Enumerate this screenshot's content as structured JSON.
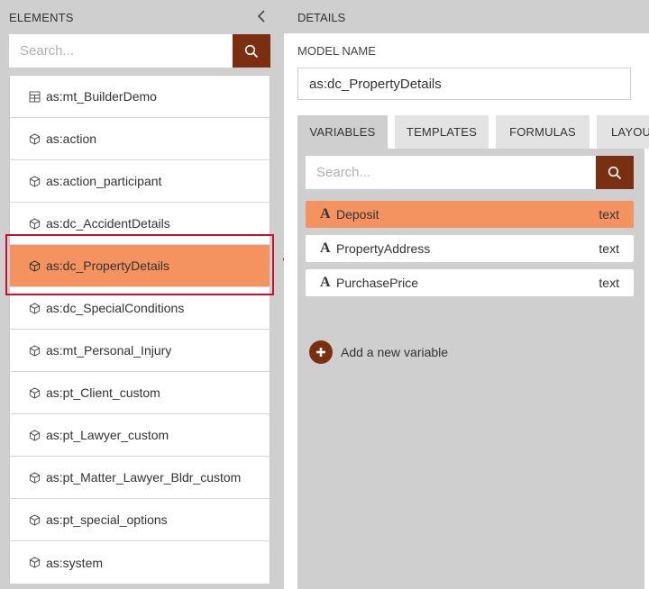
{
  "left": {
    "title": "ELEMENTS",
    "search": {
      "placeholder": "Search..."
    },
    "items": [
      {
        "label": "as:mt_BuilderDemo",
        "icon": "grid-icon"
      },
      {
        "label": "as:action",
        "icon": "cube-icon"
      },
      {
        "label": "as:action_participant",
        "icon": "cube-icon"
      },
      {
        "label": "as:dc_AccidentDetails",
        "icon": "cube-icon"
      },
      {
        "label": "as:dc_PropertyDetails",
        "icon": "cube-icon",
        "selected": true
      },
      {
        "label": "as:dc_SpecialConditions",
        "icon": "cube-icon"
      },
      {
        "label": "as:mt_Personal_Injury",
        "icon": "cube-icon"
      },
      {
        "label": "as:pt_Client_custom",
        "icon": "cube-icon"
      },
      {
        "label": "as:pt_Lawyer_custom",
        "icon": "cube-icon"
      },
      {
        "label": "as:pt_Matter_Lawyer_Bldr_custom",
        "icon": "cube-icon"
      },
      {
        "label": "as:pt_special_options",
        "icon": "cube-icon"
      },
      {
        "label": "as:system",
        "icon": "cube-icon"
      }
    ]
  },
  "details": {
    "title": "DETAILS",
    "model_name_label": "MODEL NAME",
    "model_name_value": "as:dc_PropertyDetails",
    "tabs": [
      {
        "label": "VARIABLES",
        "active": true
      },
      {
        "label": "TEMPLATES"
      },
      {
        "label": "FORMULAS"
      },
      {
        "label": "LAYOUT"
      }
    ],
    "search": {
      "placeholder": "Search..."
    },
    "variables": [
      {
        "name": "Deposit",
        "type": "text",
        "selected": true
      },
      {
        "name": "PropertyAddress",
        "type": "text"
      },
      {
        "name": "PurchasePrice",
        "type": "text"
      }
    ],
    "add_variable_label": "Add a new variable"
  },
  "colors": {
    "accent_dark": "#7a2f10",
    "selection_orange": "#f4935f",
    "highlight_red": "#c8102e",
    "panel_gray": "#cfcfcf"
  }
}
